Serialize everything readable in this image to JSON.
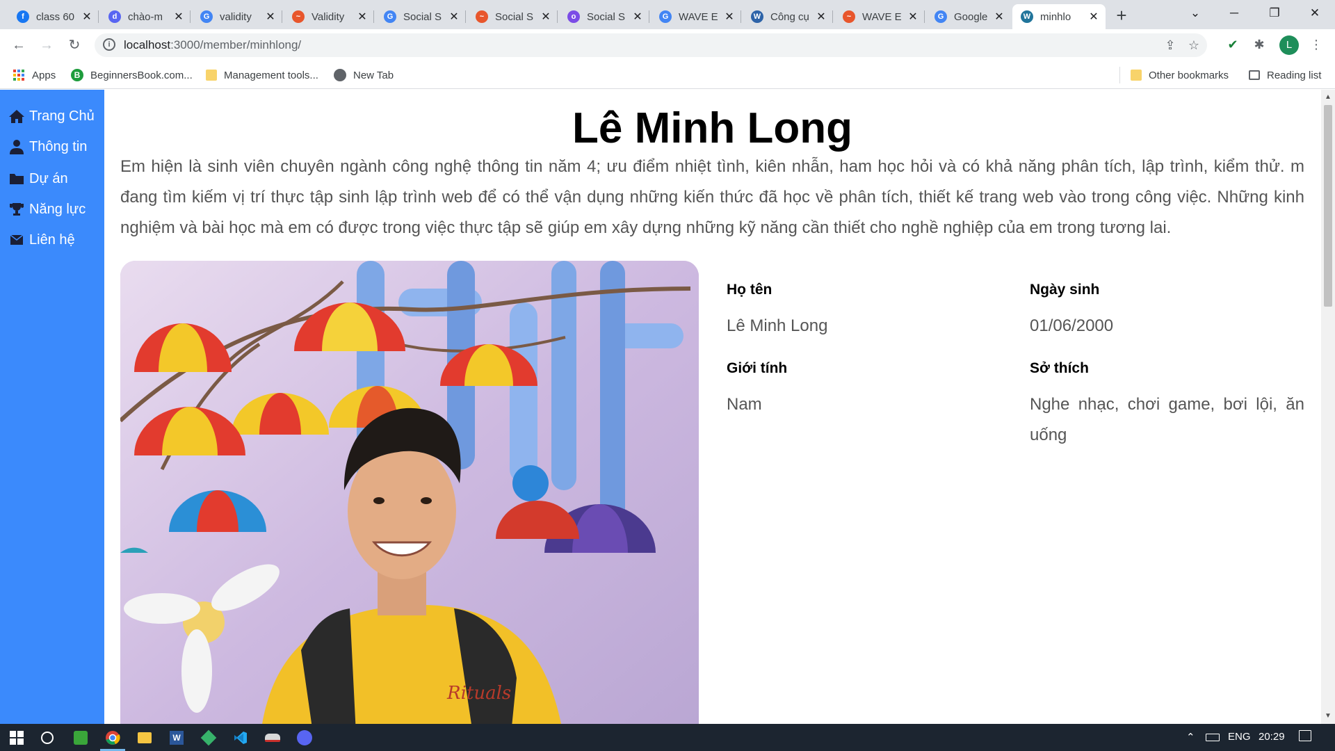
{
  "tabs": [
    {
      "title": "class 60",
      "icon": "facebook-icon",
      "color": "#1877f2",
      "glyph": "f"
    },
    {
      "title": "chào-m",
      "icon": "discord-icon",
      "color": "#5865f2",
      "glyph": "d"
    },
    {
      "title": "validity",
      "icon": "google-icon",
      "color": "#4285f4",
      "glyph": "G"
    },
    {
      "title": "Validity",
      "icon": "wave-rainbow-icon",
      "color": "#e8562c",
      "glyph": "~"
    },
    {
      "title": "Social S",
      "icon": "google-icon",
      "color": "#4285f4",
      "glyph": "G"
    },
    {
      "title": "Social S",
      "icon": "wave-rainbow-icon",
      "color": "#e8562c",
      "glyph": "~"
    },
    {
      "title": "Social S",
      "icon": "circle-logo-icon",
      "color": "#7b4ce6",
      "glyph": "o"
    },
    {
      "title": "WAVE E",
      "icon": "google-icon",
      "color": "#4285f4",
      "glyph": "G"
    },
    {
      "title": "Công cụ",
      "icon": "w-logo-icon",
      "color": "#2d63a8",
      "glyph": "W"
    },
    {
      "title": "WAVE E",
      "icon": "wave-rainbow-icon",
      "color": "#e8562c",
      "glyph": "~"
    },
    {
      "title": "Google",
      "icon": "google-translate-icon",
      "color": "#4285f4",
      "glyph": "G"
    },
    {
      "title": "minhlo",
      "icon": "wordpress-icon",
      "color": "#21759b",
      "glyph": "W"
    }
  ],
  "address": {
    "host": "localhost",
    "path": ":3000/member/minhlong/"
  },
  "profile_initial": "L",
  "bookmarks": {
    "apps": "Apps",
    "beginners": "BeginnersBook.com...",
    "management": "Management tools...",
    "newtab": "New Tab",
    "other": "Other bookmarks",
    "reading": "Reading list"
  },
  "sidebar": {
    "items": [
      {
        "label": "Trang Chủ",
        "icon": "home-icon"
      },
      {
        "label": "Thông tin",
        "icon": "user-icon"
      },
      {
        "label": "Dự án",
        "icon": "folder-icon"
      },
      {
        "label": "Năng lực",
        "icon": "trophy-icon"
      },
      {
        "label": "Liên hệ",
        "icon": "envelope-icon"
      }
    ]
  },
  "profile": {
    "name": "Lê Minh Long",
    "intro": "Em hiện là sinh viên chuyên ngành công nghệ thông tin năm 4; ưu điểm nhiệt tình, kiên nhẫn, ham học hỏi và có khả năng phân tích, lập trình, kiểm thử. m đang tìm kiếm vị trí thực tập sinh lập trình web để có thể vận dụng những kiến thức đã học về phân tích, thiết kế trang web vào trong công việc. Những kinh nghiệm và bài học mà em có được trong việc thực tập sẽ giúp em xây dựng những kỹ năng cần thiết cho nghề nghiệp của em trong tương lai.",
    "fields": {
      "name_label": "Họ tên",
      "name_value": "Lê Minh Long",
      "dob_label": "Ngày sinh",
      "dob_value": "01/06/2000",
      "gender_label": "Giới tính",
      "gender_value": "Nam",
      "hobby_label": "Sở thích",
      "hobby_value": "Nghe nhạc, chơi game, bơi lội, ăn uống"
    }
  },
  "taskbar": {
    "lang": "ENG",
    "time": "20:29"
  },
  "colors": {
    "sidebar": "#3b8afc",
    "tabstrip": "#dee1e6",
    "taskbar": "#1c2530"
  }
}
